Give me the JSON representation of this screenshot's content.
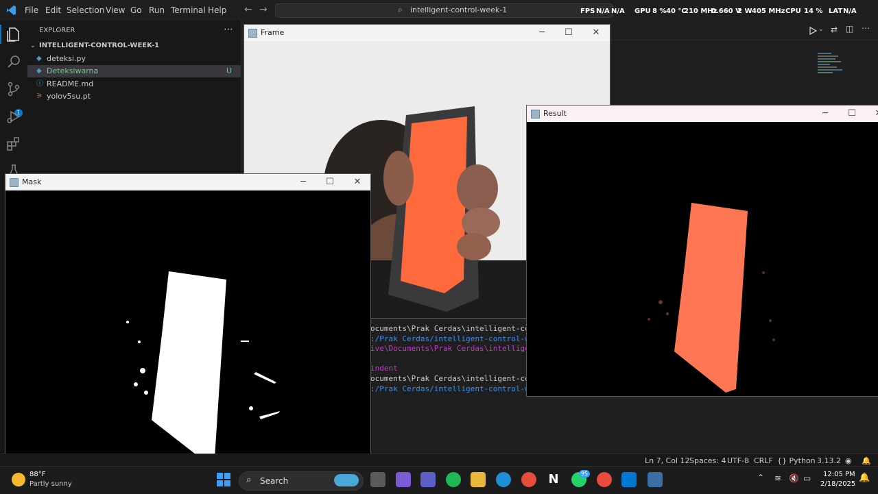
{
  "menu": [
    "File",
    "Edit",
    "Selection",
    "View",
    "Go",
    "Run",
    "Terminal",
    "Help"
  ],
  "command_center": "intelligent-control-week-1",
  "overlay": {
    "fps_label": "FPS",
    "fps_value": "N/A",
    "fps_value2": "N/A",
    "gpu_label": "GPU",
    "gpu_pct": "8 %",
    "gpu_temp": "40 °C",
    "gpu_clock": "210 MHz",
    "gpu_volt": "0.660 V",
    "gpu_power": "2 W",
    "gpu_mem": "405 MHz",
    "cpu_label": "CPU",
    "cpu_pct": "14 %",
    "lat_label": "LAT",
    "lat_value": "N/A"
  },
  "explorer": {
    "title": "EXPLORER",
    "folder": "INTELLIGENT-CONTROL-WEEK-1",
    "files": [
      {
        "name": "deteksi.py",
        "badge": ""
      },
      {
        "name": "Deteksiwarna",
        "badge": "U"
      },
      {
        "name": "README.md",
        "badge": ""
      },
      {
        "name": "yolov5su.pt",
        "badge": ""
      }
    ]
  },
  "activity_badge": "1",
  "terminal_lines": [
    {
      "text": "ocuments\\Prak Cerdas\\intelligent-contro",
      "color": "#cccccc"
    },
    {
      "text": ":/Prak Cerdas/intelligent-control-week",
      "color": "#3b8eea"
    },
    {
      "text": "ive\\Documents\\Prak Cerdas\\intelligent-c",
      "color": "#bc3fbc"
    },
    {
      "text": "",
      "color": "#cccccc"
    },
    {
      "text": " indent",
      "color": "#bc3fbc"
    },
    {
      "text": "ocuments\\Prak Cerdas\\intelligent-contro",
      "color": "#cccccc"
    },
    {
      "text": ":/Prak Cerdas/intelligent-control-week",
      "color": "#3b8eea"
    }
  ],
  "windows": {
    "frame": {
      "title": "Frame"
    },
    "mask": {
      "title": "Mask"
    },
    "result": {
      "title": "Result"
    }
  },
  "statusbar": {
    "position": "Ln 7, Col 12",
    "spaces": "Spaces: 4",
    "encoding": "UTF-8",
    "eol": "CRLF",
    "language": "{} Python",
    "version": "3.13.2"
  },
  "taskbar": {
    "weather_temp": "88°F",
    "weather_desc": "Partly sunny",
    "search_placeholder": "Search",
    "whatsapp_badge": "95",
    "time": "12:05 PM",
    "date": "2/18/2025"
  },
  "colors": {
    "accent": "#0078d4",
    "phone_screen": "#ff6a3d",
    "folder": "#dcb67a",
    "python": "#519aba"
  }
}
